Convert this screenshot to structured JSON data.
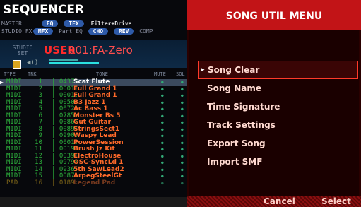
{
  "sequencer": {
    "title": "SEQUENCER",
    "master_label": "MASTER",
    "studio_fx_label": "STUDIO FX",
    "master_pills": [
      "EQ",
      "TFX"
    ],
    "master_text": "Filter+Drive",
    "studio_pills": [
      "MFX"
    ],
    "part_eq_label": "Part EQ",
    "studio_pills2": [
      "CHO",
      "REV"
    ],
    "comp_label": "COMP",
    "studio_set_label": "STUDIO SET",
    "user_prefix": "USER",
    "set_name": "001:FA-Zero",
    "columns": {
      "type": "TYPE",
      "trk": "TRK",
      "tone": "TONE",
      "mute": "MUTE",
      "solo": "SOL"
    },
    "rows": [
      {
        "type": "MIDI",
        "trk": "1",
        "num": "0437",
        "tone": "Scat Flute",
        "selected": true
      },
      {
        "type": "MIDI",
        "trk": "2",
        "num": "0001",
        "tone": "Full Grand 1"
      },
      {
        "type": "MIDI",
        "trk": "3",
        "num": "0001",
        "tone": "Full Grand 1"
      },
      {
        "type": "MIDI",
        "trk": "4",
        "num": "0050",
        "tone": "B3 Jazz 1"
      },
      {
        "type": "MIDI",
        "trk": "5",
        "num": "0072",
        "tone": "Ac Bass 1"
      },
      {
        "type": "MIDI",
        "trk": "6",
        "num": "0785",
        "tone": "Monster Bs 5"
      },
      {
        "type": "MIDI",
        "trk": "7",
        "num": "0086",
        "tone": "Gut Guitar"
      },
      {
        "type": "MIDI",
        "trk": "8",
        "num": "0089",
        "tone": "StringsSect1"
      },
      {
        "type": "MIDI",
        "trk": "9",
        "num": "0990",
        "tone": "Waspy Lead"
      },
      {
        "type": "MIDI",
        "trk": "10",
        "num": "0001",
        "tone": "PowerSession"
      },
      {
        "type": "MIDI",
        "trk": "11",
        "num": "0019",
        "tone": "Brush Jz Kit"
      },
      {
        "type": "MIDI",
        "trk": "12",
        "num": "0039",
        "tone": "ElectroHouse"
      },
      {
        "type": "MIDI",
        "trk": "13",
        "num": "0979",
        "tone": "OSC-SyncLd 1"
      },
      {
        "type": "MIDI",
        "trk": "14",
        "num": "0936",
        "tone": "5th SawLead2"
      },
      {
        "type": "MIDI",
        "trk": "15",
        "num": "0087",
        "tone": "ArpegSteelGt"
      },
      {
        "type": "PAD",
        "trk": "16",
        "num": "0189",
        "tone": "Legend Pad"
      }
    ]
  },
  "menu": {
    "title": "SONG UTIL MENU",
    "items": [
      "Song Clear",
      "Song Name",
      "Time Signature",
      "Track Settings",
      "Export Song",
      "Import SMF"
    ],
    "selected_index": 0,
    "cancel_label": "Cancel",
    "select_label": "Select"
  }
}
